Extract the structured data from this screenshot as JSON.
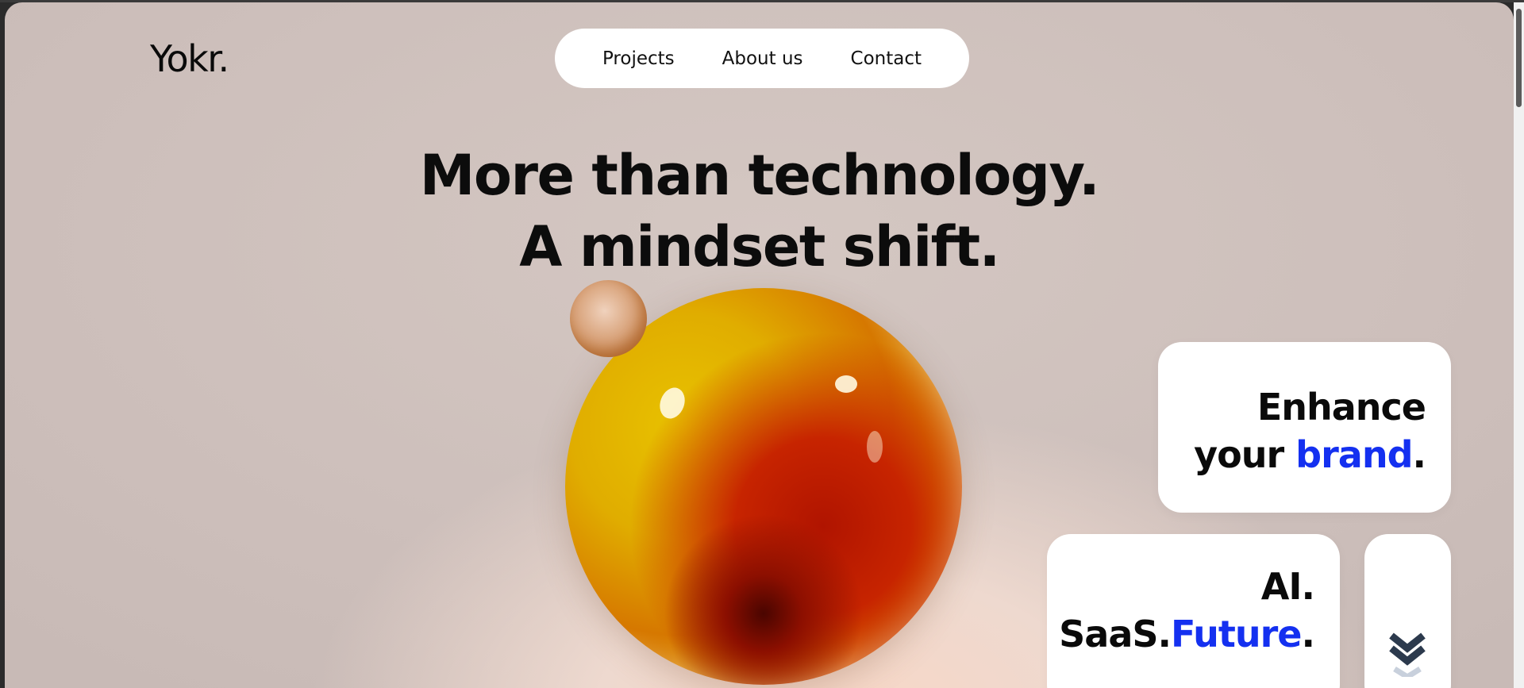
{
  "brand": {
    "logo": "Yokr."
  },
  "nav": {
    "items": [
      "Projects",
      "About us",
      "Contact"
    ]
  },
  "hero": {
    "line1": "More than technology.",
    "line2": "A mindset shift."
  },
  "cards": {
    "brand_card": {
      "line1": "Enhance",
      "line2_a": "your ",
      "line2_accent": "brand",
      "line2_b": "."
    },
    "ai_card": {
      "line1": "AI.",
      "line2_a": "SaaS.",
      "line2_accent": "Future",
      "line2_b": "."
    },
    "scroll_card": {
      "icon": "double-chevron-down-icon"
    }
  },
  "colors": {
    "accent": "#1430f0",
    "text": "#0a0a0a",
    "card_bg": "#ffffff"
  }
}
